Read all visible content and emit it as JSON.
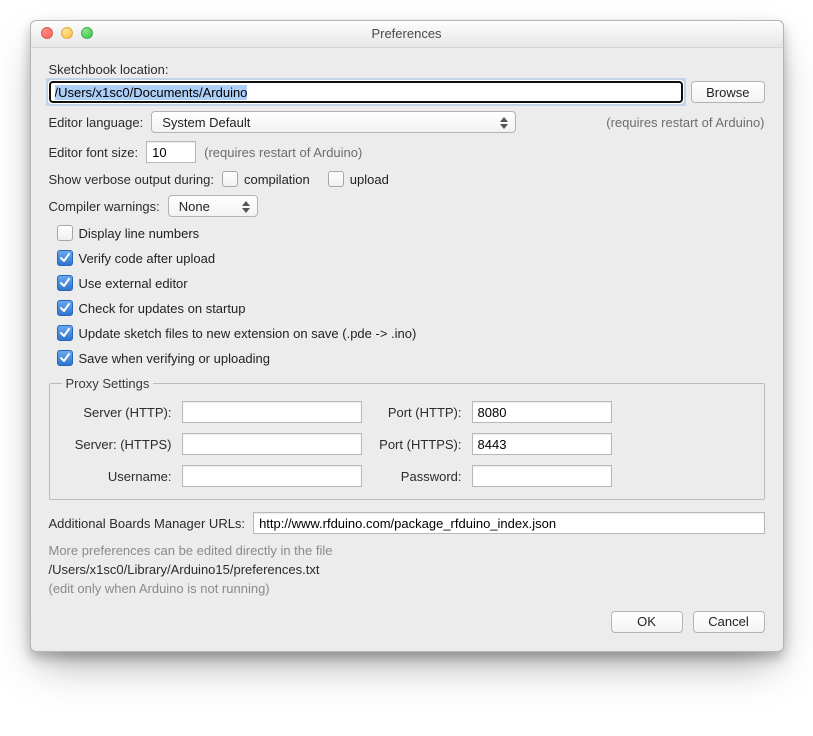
{
  "window": {
    "title": "Preferences"
  },
  "sketchbook": {
    "label": "Sketchbook location:",
    "value": "/Users/x1sc0/Documents/Arduino",
    "browse": "Browse"
  },
  "editor_language": {
    "label": "Editor language:",
    "value": "System Default",
    "hint": "(requires restart of Arduino)"
  },
  "font_size": {
    "label": "Editor font size:",
    "value": "10",
    "hint": "(requires restart of Arduino)"
  },
  "verbose": {
    "label": "Show verbose output during:",
    "compilation": {
      "label": "compilation",
      "checked": false
    },
    "upload": {
      "label": "upload",
      "checked": false
    }
  },
  "compiler_warnings": {
    "label": "Compiler warnings:",
    "value": "None"
  },
  "options": {
    "display_line_numbers": {
      "label": "Display line numbers",
      "checked": false
    },
    "verify_after_upload": {
      "label": "Verify code after upload",
      "checked": true
    },
    "external_editor": {
      "label": "Use external editor",
      "checked": true
    },
    "check_updates": {
      "label": "Check for updates on startup",
      "checked": true
    },
    "update_extension": {
      "label": "Update sketch files to new extension on save (.pde -> .ino)",
      "checked": true
    },
    "save_on_verify": {
      "label": "Save when verifying or uploading",
      "checked": true
    }
  },
  "proxy": {
    "legend": "Proxy Settings",
    "server_http_label": "Server (HTTP):",
    "server_http": "",
    "port_http_label": "Port (HTTP):",
    "port_http": "8080",
    "server_https_label": "Server: (HTTPS)",
    "server_https": "",
    "port_https_label": "Port (HTTPS):",
    "port_https": "8443",
    "username_label": "Username:",
    "username": "",
    "password_label": "Password:",
    "password": ""
  },
  "boards": {
    "label": "Additional Boards Manager URLs:",
    "value": "http://www.rfduino.com/package_rfduino_index.json"
  },
  "notes": {
    "line1": "More preferences can be edited directly in the file",
    "path": "/Users/x1sc0/Library/Arduino15/preferences.txt",
    "line2": "(edit only when Arduino is not running)"
  },
  "buttons": {
    "ok": "OK",
    "cancel": "Cancel"
  }
}
